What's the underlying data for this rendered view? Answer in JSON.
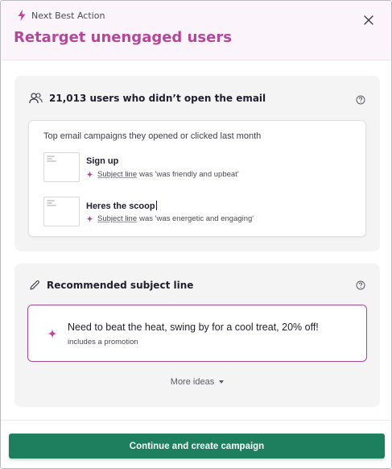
{
  "colors": {
    "accent": "#b4479c",
    "header_bg": "#fbf5fb",
    "card_bg": "#f4f4f5",
    "cta": "#1d7f5e",
    "rec_border": "#a24a9a"
  },
  "header": {
    "eyebrow": "Next Best Action",
    "eyebrow_icon": "lightning-bolt-icon",
    "title": "Retarget unengaged users",
    "close_icon": "close-icon"
  },
  "audience": {
    "icon": "users-icon",
    "heading": "21,013 users who didn’t open the email",
    "help_icon": "help-circle-icon",
    "caption": "Top email campaigns they opened or clicked last month",
    "campaigns": [
      {
        "name": "Sign up",
        "meta_link": "Subject line",
        "meta_text": "was 'was friendly and upbeat'"
      },
      {
        "name": "Heres the scoop",
        "meta_link": "Subject line",
        "meta_text": "was 'was energetic and engaging'"
      }
    ]
  },
  "subject": {
    "icon": "pencil-icon",
    "heading": "Recommended subject line",
    "help_icon": "help-circle-icon",
    "recommendation": "Need to beat the heat, swing by for a cool treat, 20% off!",
    "recommendation_note": "includes a promotion",
    "more_ideas": "More ideas"
  },
  "footer": {
    "cta_label": "Continue and create campaign"
  }
}
